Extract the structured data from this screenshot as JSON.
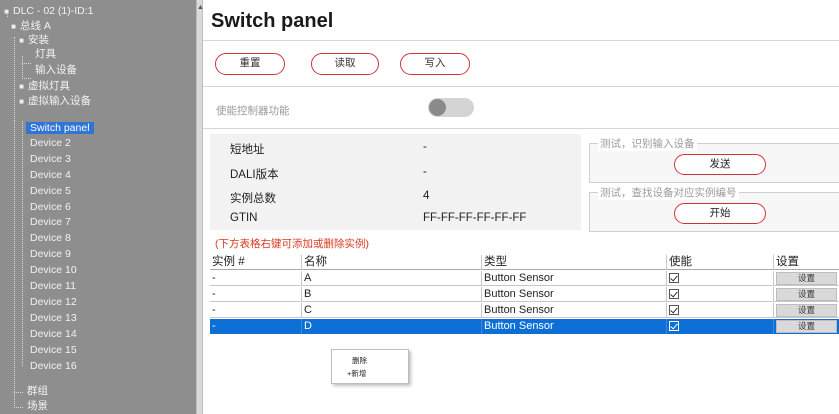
{
  "tree": {
    "root": "DLC - 02 (1)-ID:1",
    "bus": "总线 A",
    "install": "安装",
    "lamps": "灯具",
    "input_devices": "输入设备",
    "virtual_lamps": "虚拟灯具",
    "virtual_inputs": "虚拟输入设备",
    "devices": [
      "Switch panel",
      "Device 2",
      "Device 3",
      "Device 4",
      "Device 5",
      "Device 6",
      "Device 7",
      "Device 8",
      "Device 9",
      "Device 10",
      "Device 11",
      "Device 12",
      "Device 13",
      "Device 14",
      "Device 15",
      "Device 16"
    ],
    "groups": "群组",
    "scenes": "场景"
  },
  "panel": {
    "title": "Switch panel",
    "buttons": {
      "reset": "重置",
      "read": "读取",
      "write": "写入"
    },
    "enable_label": "使能控制器功能",
    "info": {
      "short_addr_label": "短地址",
      "short_addr_value": "-",
      "dali_version_label": "DALI版本",
      "dali_version_value": "-",
      "instance_count_label": "实例总数",
      "instance_count_value": "4",
      "gtin_label": "GTIN",
      "gtin_value": "FF-FF-FF-FF-FF-FF"
    },
    "test_identify": {
      "legend": "测试，识别输入设备",
      "button": "发送"
    },
    "test_find": {
      "legend": "测试，查找设备对应实例编号",
      "button": "开始"
    },
    "hint": "(下方表格右键可添加或删除实例)"
  },
  "table": {
    "columns": [
      "实例 #",
      "名称",
      "类型",
      "使能",
      "设置"
    ],
    "rows": [
      {
        "instance": "-",
        "name": "A",
        "type": "Button Sensor",
        "enabled": true,
        "setting": "设置"
      },
      {
        "instance": "-",
        "name": "B",
        "type": "Button Sensor",
        "enabled": true,
        "setting": "设置"
      },
      {
        "instance": "-",
        "name": "C",
        "type": "Button Sensor",
        "enabled": true,
        "setting": "设置"
      },
      {
        "instance": "-",
        "name": "D",
        "type": "Button Sensor",
        "enabled": true,
        "setting": "设置"
      }
    ],
    "selected_row": 3
  },
  "context_menu": {
    "delete": "删除",
    "add": "+新增"
  },
  "colors": {
    "tree_bg": "#8e8e8e",
    "selection": "#0d6fd6",
    "accent_red": "#d0343b",
    "hint_red": "#d83a1e"
  }
}
